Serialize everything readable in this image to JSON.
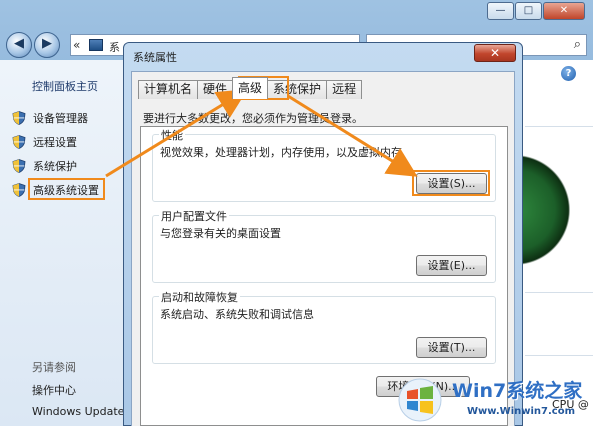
{
  "window": {
    "caption_minimize": "—",
    "caption_maximize": "□",
    "caption_close": "✕",
    "nav_back": "◀",
    "nav_forward": "▶",
    "address_prefix": "«",
    "address_text": "系",
    "address_text_tail": "系统",
    "search_icon": "⌕"
  },
  "sidebar": {
    "home": "控制面板主页",
    "items": [
      {
        "label": "设备管理器",
        "icon": "shield-icon"
      },
      {
        "label": "远程设置",
        "icon": "shield-icon"
      },
      {
        "label": "系统保护",
        "icon": "shield-icon"
      },
      {
        "label": "高级系统设置",
        "icon": "shield-icon"
      }
    ],
    "see_also": "另请参阅",
    "links": [
      "操作中心",
      "Windows Update"
    ]
  },
  "main": {
    "help": "?",
    "cpu": "CPU @"
  },
  "dialog": {
    "title": "系统属性",
    "close": "✕",
    "tabs": [
      "计算机名",
      "硬件",
      "高级",
      "系统保护",
      "远程"
    ],
    "active_tab": "高级",
    "admin_note": "要进行大多数更改，您必须作为管理员登录。",
    "groups": [
      {
        "title": "性能",
        "desc": "视觉效果，处理器计划，内存使用，以及虚拟内存",
        "button": "设置(S)..."
      },
      {
        "title": "用户配置文件",
        "desc": "与您登录有关的桌面设置",
        "button": "设置(E)..."
      },
      {
        "title": "启动和故障恢复",
        "desc": "系统启动、系统失败和调试信息",
        "button": "设置(T)..."
      }
    ],
    "env_button": "环境变量(N)..."
  },
  "watermark": {
    "brand": "Win7系统之家",
    "url": "Www.Winwin7.com"
  },
  "colors": {
    "highlight": "#f08a1c",
    "dialog_frame": "#a9c7e6",
    "close_red": "#c1452c"
  }
}
